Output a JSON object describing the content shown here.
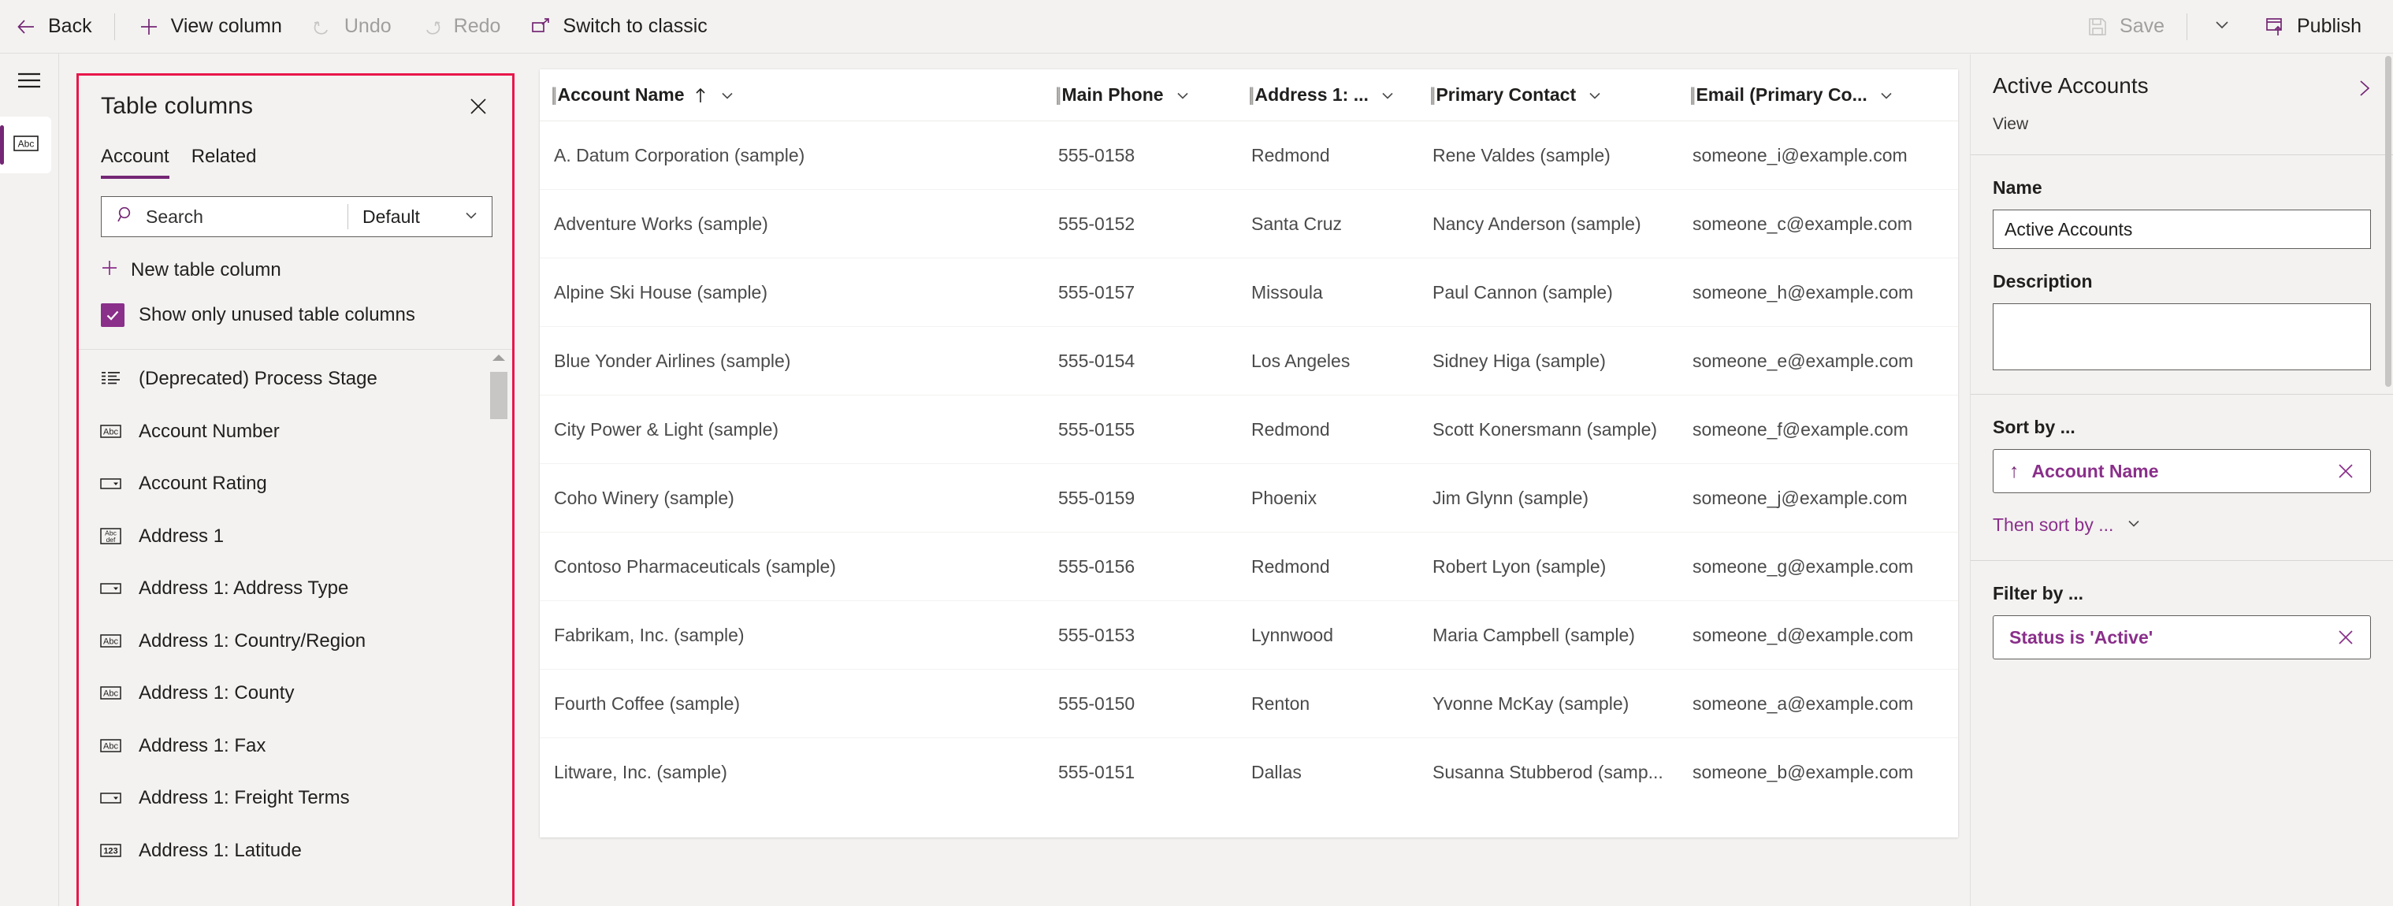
{
  "commandbar": {
    "back": {
      "label": "Back",
      "icon": "arrow-left-icon"
    },
    "view_column": {
      "label": "View column",
      "icon": "plus-icon"
    },
    "undo": {
      "label": "Undo",
      "icon": "undo-icon"
    },
    "redo": {
      "label": "Redo",
      "icon": "redo-icon"
    },
    "switch_classic": {
      "label": "Switch to classic",
      "icon": "external-window-icon"
    },
    "save": {
      "label": "Save",
      "icon": "save-disk-icon"
    },
    "publish": {
      "label": "Publish",
      "icon": "publish-icon"
    }
  },
  "rail": {
    "menu": "hamburger-menu-icon",
    "item": "abc-text-field-icon"
  },
  "table_columns": {
    "title": "Table columns",
    "close": "close-icon",
    "tabs": [
      {
        "label": "Account",
        "active": true
      },
      {
        "label": "Related",
        "active": false
      }
    ],
    "search": {
      "placeholder": "Search",
      "icon": "search-icon"
    },
    "filter": {
      "value": "Default",
      "icon": "chevron-down-icon"
    },
    "new_column": {
      "label": "New table column",
      "icon": "plus-icon"
    },
    "show_unused": {
      "label": "Show only unused table columns",
      "checked": true
    },
    "columns": [
      {
        "label": "(Deprecated) Process Stage",
        "type": "list"
      },
      {
        "label": "Account Number",
        "type": "abc"
      },
      {
        "label": "Account Rating",
        "type": "optionset"
      },
      {
        "label": "Address 1",
        "type": "multiline"
      },
      {
        "label": "Address 1: Address Type",
        "type": "optionset"
      },
      {
        "label": "Address 1: Country/Region",
        "type": "abc"
      },
      {
        "label": "Address 1: County",
        "type": "abc"
      },
      {
        "label": "Address 1: Fax",
        "type": "abc"
      },
      {
        "label": "Address 1: Freight Terms",
        "type": "optionset"
      },
      {
        "label": "Address 1: Latitude",
        "type": "number"
      }
    ]
  },
  "grid": {
    "columns": [
      {
        "label": "Account Name",
        "sorted": "ascending",
        "truncated": false
      },
      {
        "label": "Main Phone",
        "sorted": "",
        "truncated": false
      },
      {
        "label": "Address 1: ...",
        "sorted": "",
        "truncated": true
      },
      {
        "label": "Primary Contact",
        "sorted": "",
        "truncated": false
      },
      {
        "label": "Email (Primary Co...",
        "sorted": "",
        "truncated": true
      }
    ],
    "rows": [
      [
        "A. Datum Corporation (sample)",
        "555-0158",
        "Redmond",
        "Rene Valdes (sample)",
        "someone_i@example.com"
      ],
      [
        "Adventure Works (sample)",
        "555-0152",
        "Santa Cruz",
        "Nancy Anderson (sample)",
        "someone_c@example.com"
      ],
      [
        "Alpine Ski House (sample)",
        "555-0157",
        "Missoula",
        "Paul Cannon (sample)",
        "someone_h@example.com"
      ],
      [
        "Blue Yonder Airlines (sample)",
        "555-0154",
        "Los Angeles",
        "Sidney Higa (sample)",
        "someone_e@example.com"
      ],
      [
        "City Power & Light (sample)",
        "555-0155",
        "Redmond",
        "Scott Konersmann (sample)",
        "someone_f@example.com"
      ],
      [
        "Coho Winery (sample)",
        "555-0159",
        "Phoenix",
        "Jim Glynn (sample)",
        "someone_j@example.com"
      ],
      [
        "Contoso Pharmaceuticals (sample)",
        "555-0156",
        "Redmond",
        "Robert Lyon (sample)",
        "someone_g@example.com"
      ],
      [
        "Fabrikam, Inc. (sample)",
        "555-0153",
        "Lynnwood",
        "Maria Campbell (sample)",
        "someone_d@example.com"
      ],
      [
        "Fourth Coffee (sample)",
        "555-0150",
        "Renton",
        "Yvonne McKay (sample)",
        "someone_a@example.com"
      ],
      [
        "Litware, Inc. (sample)",
        "555-0151",
        "Dallas",
        "Susanna Stubberod (samp...",
        "someone_b@example.com"
      ]
    ]
  },
  "properties": {
    "title": "Active Accounts",
    "subtitle": "View",
    "expand_icon": "chevron-right-icon",
    "name": {
      "label": "Name",
      "value": "Active Accounts"
    },
    "description": {
      "label": "Description",
      "value": ""
    },
    "sort_by": {
      "label": "Sort by ...",
      "pill": {
        "text": "Account Name",
        "direction": "ascending",
        "remove": "close-icon"
      },
      "then": {
        "label": "Then sort by ...",
        "icon": "chevron-down-icon"
      }
    },
    "filter_by": {
      "label": "Filter by ...",
      "pill": {
        "text": "Status is 'Active'",
        "remove": "close-icon"
      }
    }
  },
  "colors": {
    "accent": "#742774",
    "accent_text": "#8a2f8a",
    "highlight_border": "#e8174a",
    "chrome": "#f3f2f1"
  }
}
